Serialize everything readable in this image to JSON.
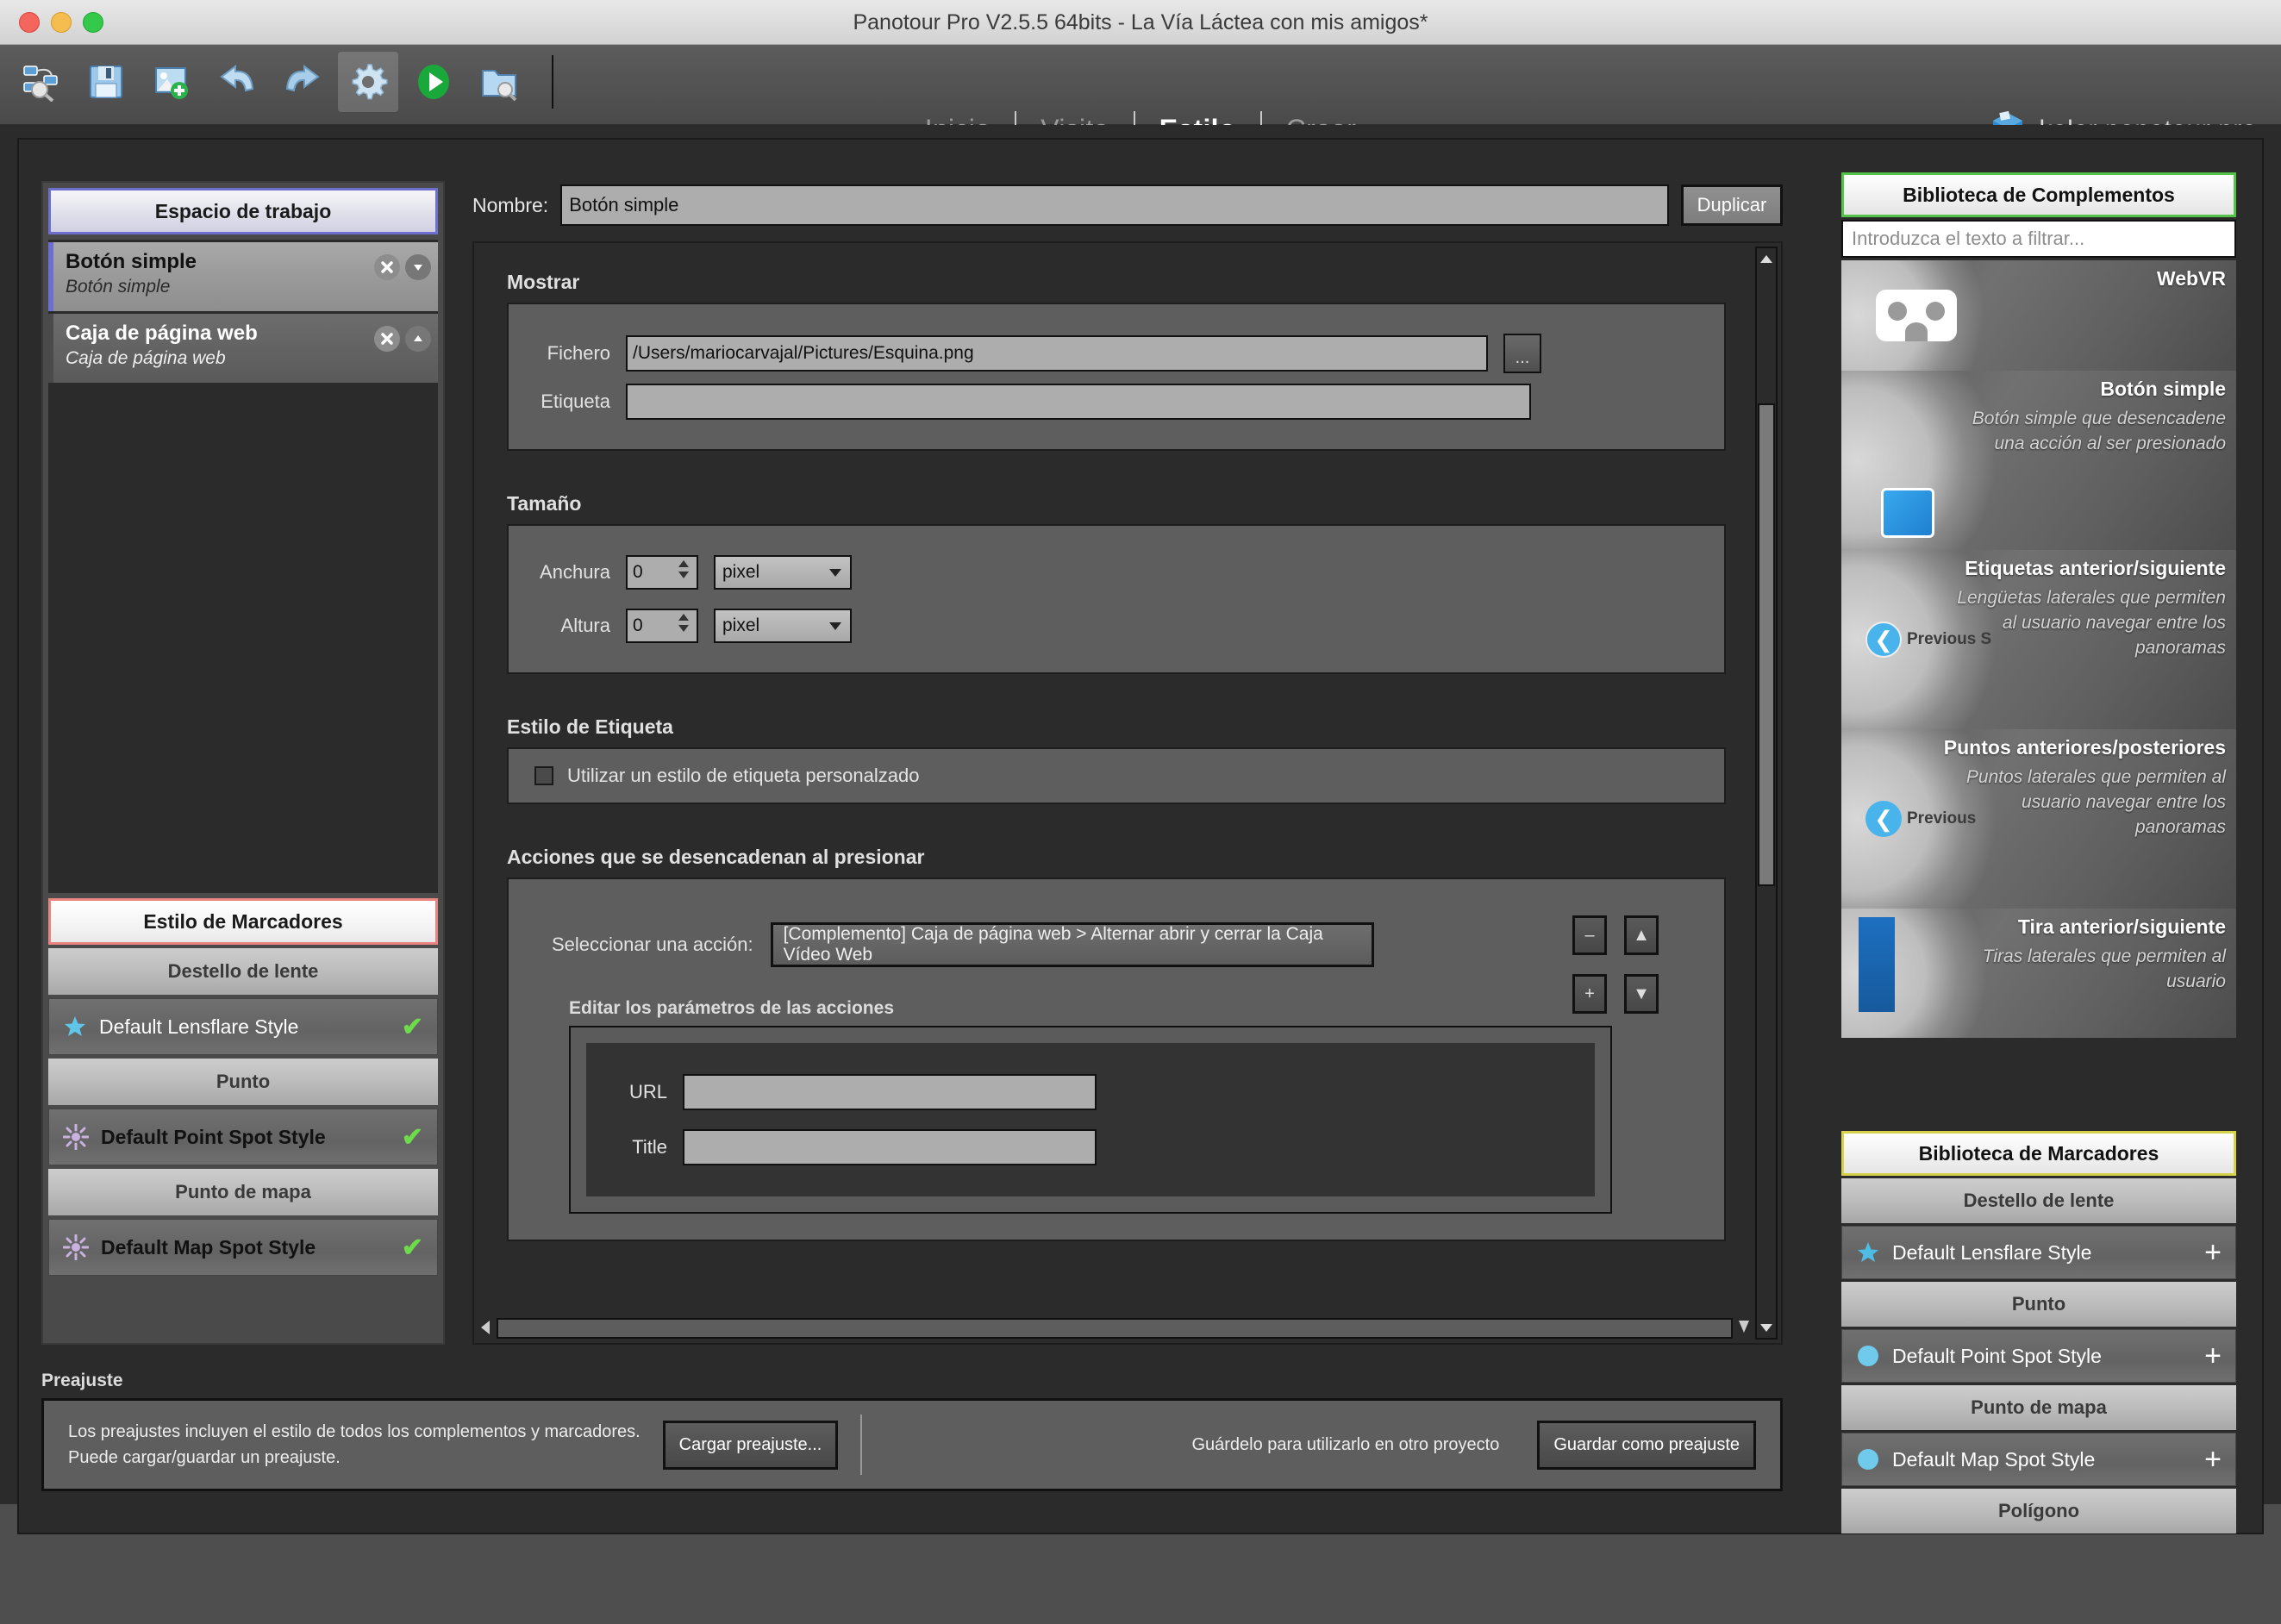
{
  "window": {
    "title": "Panotour Pro V2.5.5 64bits - La Vía Láctea con mis amigos*"
  },
  "toolbar": {
    "icons": [
      {
        "name": "project-overview-icon",
        "label": "Vista general del proyecto"
      },
      {
        "name": "save-icon",
        "label": "Guardar"
      },
      {
        "name": "add-image-icon",
        "label": "Añadir imagen"
      },
      {
        "name": "undo-icon",
        "label": "Deshacer"
      },
      {
        "name": "redo-icon",
        "label": "Rehacer"
      },
      {
        "name": "gear-icon",
        "label": "Preferencias"
      },
      {
        "name": "play-icon",
        "label": "Generar"
      },
      {
        "name": "open-folder-icon",
        "label": "Abrir carpeta"
      }
    ]
  },
  "nav": {
    "tabs": [
      {
        "label": "Inicio",
        "selected": false
      },
      {
        "label": "Visita",
        "selected": false
      },
      {
        "label": "Estilo",
        "selected": true
      },
      {
        "label": "Crear",
        "selected": false
      }
    ]
  },
  "brand": {
    "logo_text": "ptp",
    "name": "kolor panotour pro"
  },
  "sidebar": {
    "workspace_header": "Espacio de trabajo",
    "items": [
      {
        "title": "Botón simple",
        "subtitle": "Botón simple",
        "selected": true,
        "close": "✕",
        "move": "▼"
      },
      {
        "title": "Caja de página web",
        "subtitle": "Caja de página web",
        "selected": false,
        "close": "✕",
        "move": "▲"
      }
    ],
    "markers_header": "Estilo de Marcadores",
    "groups": [
      {
        "label": "Destello de lente",
        "style": "Default Lensflare Style",
        "icon": "star-icon",
        "check": "✔",
        "bold": false
      },
      {
        "label": "Punto",
        "style": "Default Point Spot Style",
        "icon": "spot-icon",
        "check": "✔",
        "bold": true
      },
      {
        "label": "Punto de mapa",
        "style": "Default Map Spot Style",
        "icon": "spot-icon",
        "check": "✔",
        "bold": false
      }
    ]
  },
  "main": {
    "name_label": "Nombre:",
    "name_value": "Botón simple",
    "duplicate_button": "Duplicar",
    "show_section": {
      "title": "Mostrar",
      "file_label": "Fichero",
      "file_value": "/Users/mariocarvajal/Pictures/Esquina.png",
      "browse_button": "...",
      "label_label": "Etiqueta",
      "label_value": ""
    },
    "size_section": {
      "title": "Tamaño",
      "width_label": "Anchura",
      "width_value": "0",
      "width_unit": "pixel",
      "height_label": "Altura",
      "height_value": "0",
      "height_unit": "pixel"
    },
    "label_style_section": {
      "title": "Estilo de Etiqueta",
      "checkbox_label": "Utilizar un estilo de etiqueta personalzado",
      "checked": false
    },
    "actions_section": {
      "title": "Acciones que se desencadenan al presionar",
      "select_label": "Seleccionar una acción:",
      "select_value": "[Complemento] Caja de página web > Alternar abrir y cerrar la Caja Vídeo Web",
      "buttons": [
        {
          "name": "remove-action-button",
          "glyph": "–"
        },
        {
          "name": "move-action-up-button",
          "glyph": "▲"
        },
        {
          "name": "add-action-button",
          "glyph": "+"
        },
        {
          "name": "move-action-down-button",
          "glyph": "▼"
        }
      ],
      "params_title": "Editar los parámetros de las acciones",
      "params": [
        {
          "label": "URL",
          "value": ""
        },
        {
          "label": "Title",
          "value": ""
        }
      ]
    }
  },
  "library": {
    "plugins_header": "Biblioteca de Complementos",
    "filter_placeholder": "Introduzca el texto a filtrar...",
    "cards": [
      {
        "title": "WebVR",
        "desc": "",
        "thumb": "vr-goggles"
      },
      {
        "title": "Botón simple",
        "desc": "Botón simple que desencadene una acción al ser presionado",
        "thumb": "blue-square"
      },
      {
        "title": "Etiquetas anterior/siguiente",
        "desc": "Lengüetas laterales que permiten al usuario navegar entre los panoramas",
        "thumb": "previous-tab"
      },
      {
        "title": "Puntos anteriores/posteriores",
        "desc": "Puntos laterales que permiten al usuario navegar entre los panoramas",
        "thumb": "previous-spot"
      },
      {
        "title": "Tira anterior/siguiente",
        "desc": "Tiras laterales que permiten al usuario",
        "thumb": "blue-strip"
      }
    ],
    "markers_header": "Biblioteca de Marcadores",
    "groups": [
      {
        "label": "Destello de lente",
        "style": "Default Lensflare Style",
        "icon": "star-icon",
        "add": "+"
      },
      {
        "label": "Punto",
        "style": "Default Point Spot Style",
        "icon": "circle-icon",
        "add": "+"
      },
      {
        "label": "Punto de mapa",
        "style": "Default Map Spot Style",
        "icon": "circle-icon",
        "add": "+"
      },
      {
        "label": "Polígono",
        "style": "",
        "icon": "",
        "add": ""
      }
    ]
  },
  "preset": {
    "title": "Preajuste",
    "description_line1": "Los preajustes incluyen el estilo de todos los complementos y marcadores.",
    "description_line2": "Puede cargar/guardar un preajuste.",
    "load_button": "Cargar preajuste...",
    "save_note": "Guárdelo para utilizarlo en otro proyecto",
    "save_button": "Guardar como preajuste"
  },
  "colors": {
    "accent_green": "#53c34a",
    "accent_yellow": "#d6d24a",
    "accent_purple": "#6e6ecf",
    "accent_red": "#e8837f",
    "check_green": "#6ddb4a"
  }
}
